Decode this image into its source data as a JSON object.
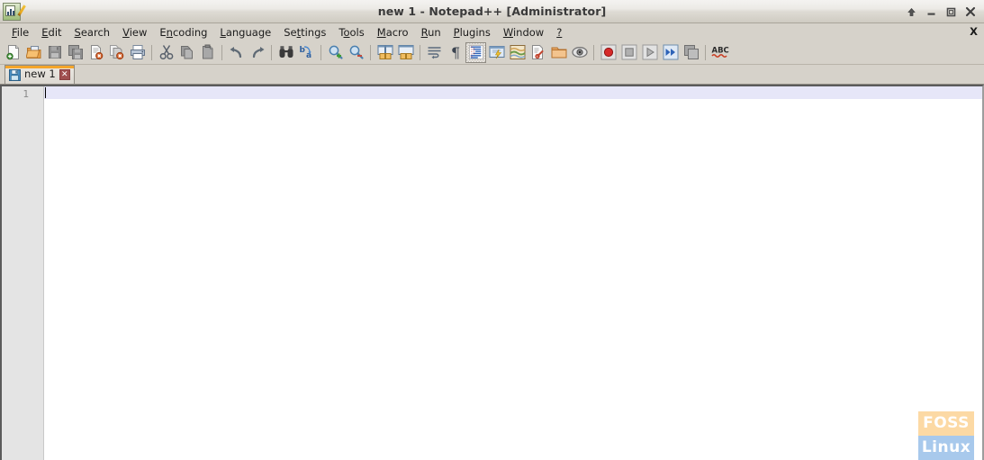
{
  "window": {
    "title": "new 1 - Notepad++ [Administrator]",
    "app_icon": "notepadpp-icon",
    "controls": [
      {
        "name": "rollup-button",
        "icon": "arrow-up-icon",
        "label": "↑"
      },
      {
        "name": "minimize-button",
        "icon": "minimize-icon",
        "label": "–"
      },
      {
        "name": "maximize-button",
        "icon": "maximize-icon",
        "label": "☐"
      },
      {
        "name": "close-button",
        "icon": "close-icon",
        "label": "✕"
      }
    ]
  },
  "menubar": {
    "items": [
      {
        "label": "File",
        "name": "menu-file"
      },
      {
        "label": "Edit",
        "name": "menu-edit"
      },
      {
        "label": "Search",
        "name": "menu-search"
      },
      {
        "label": "View",
        "name": "menu-view"
      },
      {
        "label": "Encoding",
        "name": "menu-encoding"
      },
      {
        "label": "Language",
        "name": "menu-language"
      },
      {
        "label": "Settings",
        "name": "menu-settings"
      },
      {
        "label": "Tools",
        "name": "menu-tools"
      },
      {
        "label": "Macro",
        "name": "menu-macro"
      },
      {
        "label": "Run",
        "name": "menu-run"
      },
      {
        "label": "Plugins",
        "name": "menu-plugins"
      },
      {
        "label": "Window",
        "name": "menu-window"
      },
      {
        "label": "?",
        "name": "menu-help"
      }
    ],
    "close_document_label": "X"
  },
  "toolbar": {
    "buttons": [
      {
        "name": "new-file-button",
        "icon": "new-file-icon",
        "tooltip": "New"
      },
      {
        "name": "open-file-button",
        "icon": "open-folder-icon",
        "tooltip": "Open"
      },
      {
        "name": "save-button",
        "icon": "save-icon",
        "tooltip": "Save"
      },
      {
        "name": "save-all-button",
        "icon": "save-all-icon",
        "tooltip": "Save All"
      },
      {
        "name": "close-document-button",
        "icon": "close-document-icon",
        "tooltip": "Close"
      },
      {
        "name": "close-all-button",
        "icon": "close-all-icon",
        "tooltip": "Close All"
      },
      {
        "name": "print-button",
        "icon": "printer-icon",
        "tooltip": "Print"
      },
      {
        "name": "separator-1",
        "icon": "separator",
        "tooltip": ""
      },
      {
        "name": "cut-button",
        "icon": "scissors-icon",
        "tooltip": "Cut"
      },
      {
        "name": "copy-button",
        "icon": "copy-icon",
        "tooltip": "Copy"
      },
      {
        "name": "paste-button",
        "icon": "paste-icon",
        "tooltip": "Paste"
      },
      {
        "name": "separator-2",
        "icon": "separator",
        "tooltip": ""
      },
      {
        "name": "undo-button",
        "icon": "undo-arrow-icon",
        "tooltip": "Undo"
      },
      {
        "name": "redo-button",
        "icon": "redo-arrow-icon",
        "tooltip": "Redo"
      },
      {
        "name": "separator-3",
        "icon": "separator",
        "tooltip": ""
      },
      {
        "name": "find-button",
        "icon": "binoculars-icon",
        "tooltip": "Find"
      },
      {
        "name": "replace-button",
        "icon": "replace-icon",
        "tooltip": "Replace"
      },
      {
        "name": "separator-4",
        "icon": "separator",
        "tooltip": ""
      },
      {
        "name": "zoom-in-button",
        "icon": "zoom-in-icon",
        "tooltip": "Zoom In"
      },
      {
        "name": "zoom-out-button",
        "icon": "zoom-out-icon",
        "tooltip": "Zoom Out"
      },
      {
        "name": "separator-5",
        "icon": "separator",
        "tooltip": ""
      },
      {
        "name": "sync-vertical-button",
        "icon": "sync-vertical-icon",
        "tooltip": "Synchronize Vertical Scrolling"
      },
      {
        "name": "sync-horizontal-button",
        "icon": "sync-horizontal-icon",
        "tooltip": "Synchronize Horizontal Scrolling"
      },
      {
        "name": "separator-6",
        "icon": "separator",
        "tooltip": ""
      },
      {
        "name": "word-wrap-button",
        "icon": "word-wrap-icon",
        "tooltip": "Word wrap"
      },
      {
        "name": "show-all-chars-button",
        "icon": "pilcrow-icon",
        "tooltip": "Show All Characters"
      },
      {
        "name": "indent-guide-button",
        "icon": "indent-guide-icon",
        "tooltip": "Show Indent Guide",
        "active": true
      },
      {
        "name": "udl-dialog-button",
        "icon": "udl-icon",
        "tooltip": "User Defined Language"
      },
      {
        "name": "document-map-button",
        "icon": "document-map-icon",
        "tooltip": "Document Map"
      },
      {
        "name": "function-list-button",
        "icon": "function-list-icon",
        "tooltip": "Function List"
      },
      {
        "name": "folder-workspace-button",
        "icon": "folder-workspace-icon",
        "tooltip": "Folder as Workspace"
      },
      {
        "name": "monitoring-button",
        "icon": "monitoring-eye-icon",
        "tooltip": "Monitoring"
      },
      {
        "name": "separator-7",
        "icon": "separator",
        "tooltip": ""
      },
      {
        "name": "macro-record-button",
        "icon": "record-icon",
        "tooltip": "Start Recording"
      },
      {
        "name": "macro-stop-button",
        "icon": "stop-icon",
        "tooltip": "Stop Recording"
      },
      {
        "name": "macro-play-button",
        "icon": "play-icon",
        "tooltip": "Playback"
      },
      {
        "name": "macro-fastplay-button",
        "icon": "fast-forward-icon",
        "tooltip": "Run a Macro Multiple Times"
      },
      {
        "name": "macro-save-button",
        "icon": "save-macro-icon",
        "tooltip": "Save Currently Recorded Macro"
      },
      {
        "name": "separator-8",
        "icon": "separator",
        "tooltip": ""
      },
      {
        "name": "spellcheck-button",
        "icon": "abc-spellcheck-icon",
        "tooltip": "Spell Checker",
        "label": "ABC"
      }
    ],
    "spellcheck_label": "ABC"
  },
  "tabs": [
    {
      "name": "tab-new-1",
      "label": "new 1",
      "active": true,
      "save_icon": "floppy-disk-icon",
      "close_label": "✕"
    }
  ],
  "editor": {
    "lines": [
      "1"
    ],
    "content": "",
    "current_line": 1,
    "gutter_bg": "#e4e4e4",
    "current_line_highlight": "#e6e6f8",
    "background": "#ffffff"
  },
  "watermark": {
    "top_text": "FOSS",
    "bottom_text": "Linux",
    "top_bg": "#fcd9a4",
    "bottom_bg": "#a8c9ec",
    "text_color": "#ffffff"
  },
  "theme": {
    "window_bg": "#d6d2ca",
    "titlebar_text": "#3a3a3a",
    "tab_active_indicator": "#f4a52a",
    "tab_close_red": "#a04f4f"
  }
}
